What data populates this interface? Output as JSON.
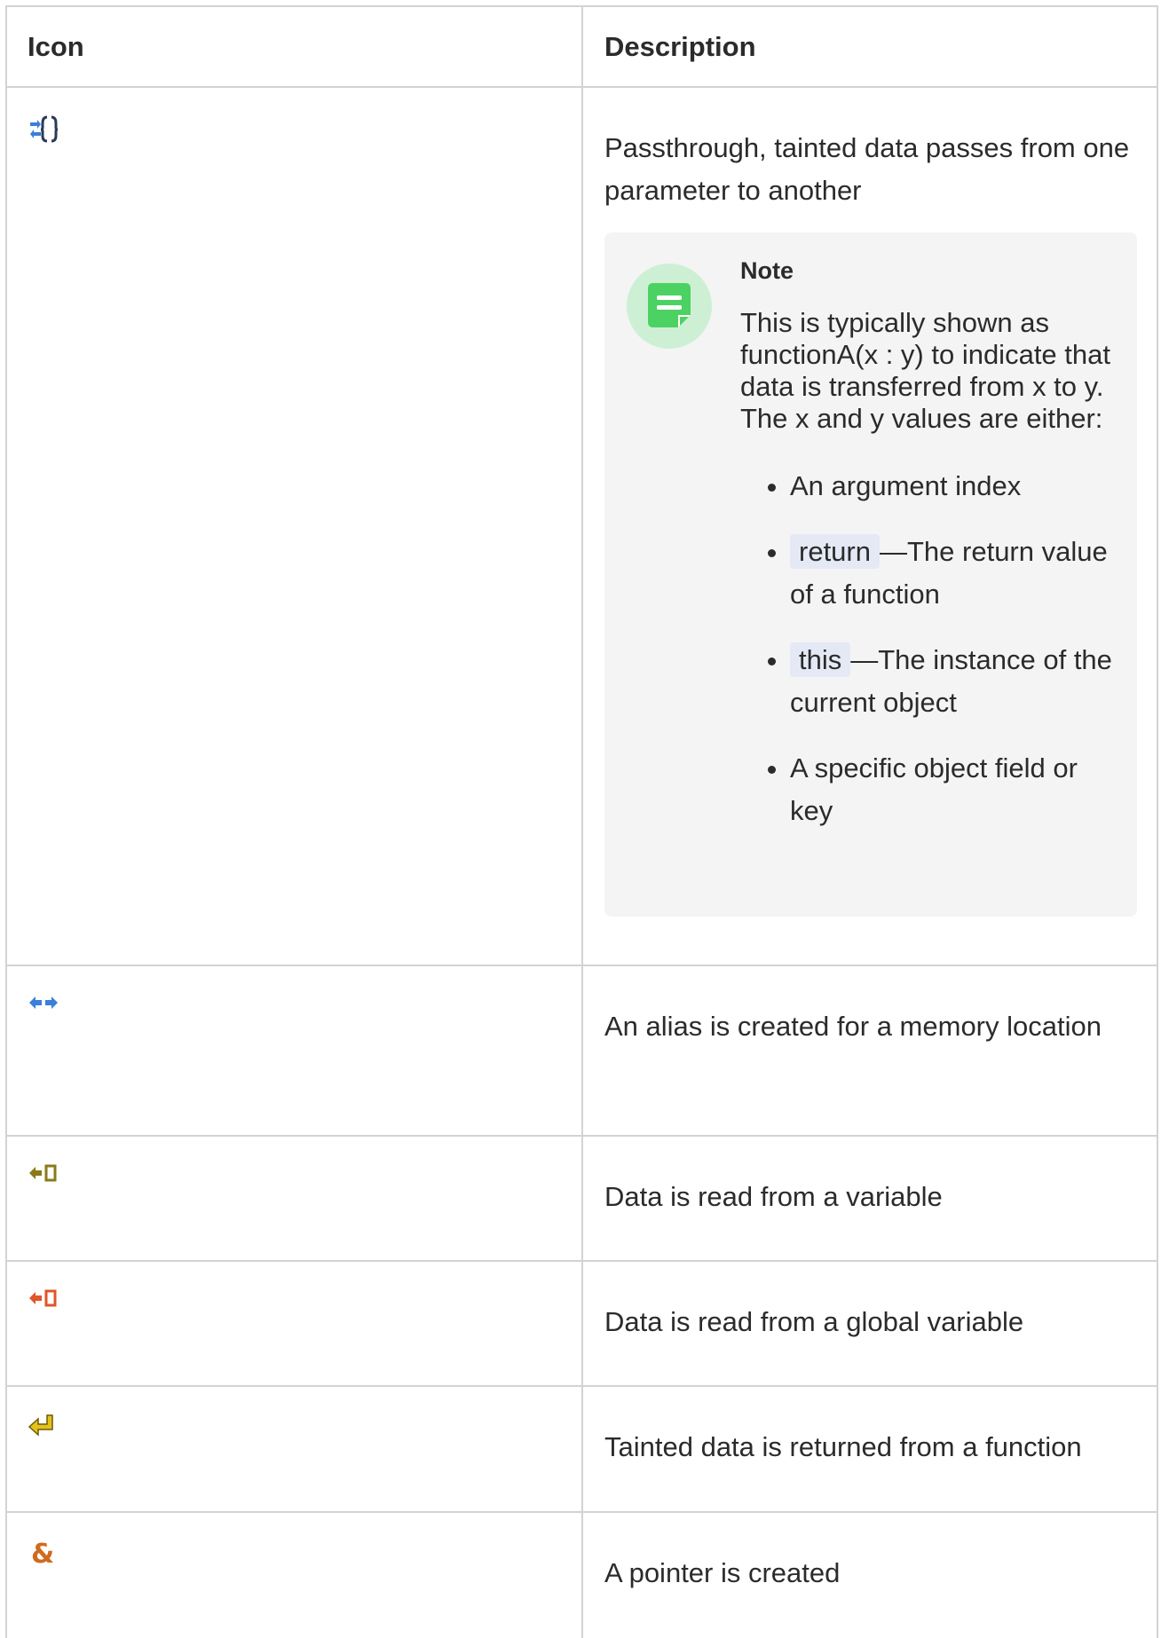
{
  "table": {
    "headers": {
      "icon": "Icon",
      "description": "Description"
    },
    "rows": [
      {
        "icon": "passthrough-icon",
        "description": "Passthrough, tainted data passes from one parameter to another"
      },
      {
        "icon": "alias-icon",
        "description": "An alias is created for a memory location"
      },
      {
        "icon": "read-variable-icon",
        "description": "Data is read from a variable"
      },
      {
        "icon": "read-global-variable-icon",
        "description": "Data is read from a global variable"
      },
      {
        "icon": "return-icon",
        "description": "Tainted data is returned from a function"
      },
      {
        "icon": "pointer-icon",
        "description": "A pointer is created"
      }
    ]
  },
  "note": {
    "title": "Note",
    "text": "This is typically shown as functionA(x : y) to indicate that data is transferred from x to y. The x and y values are either:",
    "items": [
      {
        "text": "An argument index"
      },
      {
        "code": "return",
        "text": "—The return value of a function"
      },
      {
        "code": "this",
        "text": "—The instance of the current object"
      },
      {
        "text": "A specific object field or key"
      }
    ]
  },
  "pointer_glyph": "&",
  "colors": {
    "border": "#d3d3d3",
    "note_bg": "#f4f4f4",
    "note_icon_bg": "#cdf0d5",
    "note_icon": "#4cd263",
    "code_bg": "#e4e9f5"
  }
}
